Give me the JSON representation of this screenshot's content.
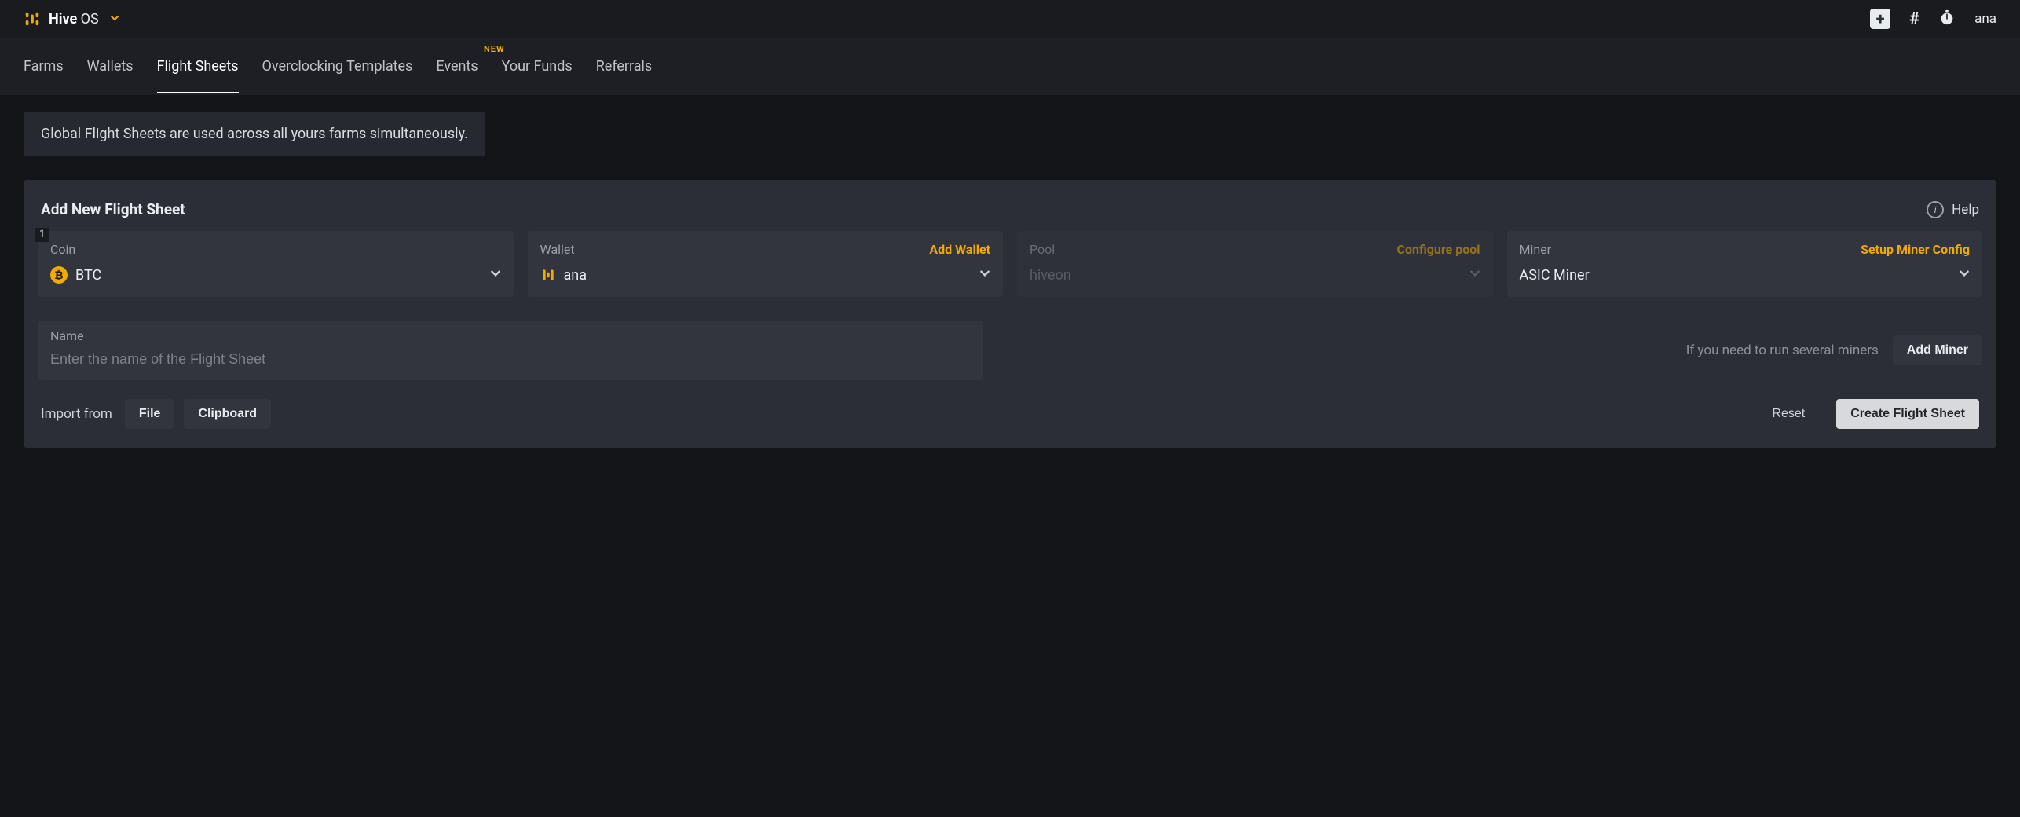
{
  "header": {
    "brand_prefix": "Hive",
    "brand_suffix": "OS",
    "username": "ana"
  },
  "tabs": {
    "farms": "Farms",
    "wallets": "Wallets",
    "flight_sheets": "Flight Sheets",
    "oc_templates": "Overclocking Templates",
    "events": "Events",
    "events_badge": "NEW",
    "your_funds": "Your Funds",
    "referrals": "Referrals"
  },
  "info": "Global Flight Sheets are used across all yours farms simultaneously.",
  "panel": {
    "title": "Add New Flight Sheet",
    "help_label": "Help",
    "step": "1"
  },
  "coin": {
    "label": "Coin",
    "value": "BTC"
  },
  "wallet": {
    "label": "Wallet",
    "action": "Add Wallet",
    "value": "ana"
  },
  "pool": {
    "label": "Pool",
    "action": "Configure pool",
    "value": "hiveon"
  },
  "miner": {
    "label": "Miner",
    "action": "Setup Miner Config",
    "value": "ASIC Miner"
  },
  "name": {
    "label": "Name",
    "placeholder": "Enter the name of the Flight Sheet"
  },
  "addminer": {
    "hint": "If you need to run several miners",
    "button": "Add Miner"
  },
  "bottom": {
    "import_label": "Import from",
    "file": "File",
    "clipboard": "Clipboard",
    "reset": "Reset",
    "create": "Create Flight Sheet"
  }
}
